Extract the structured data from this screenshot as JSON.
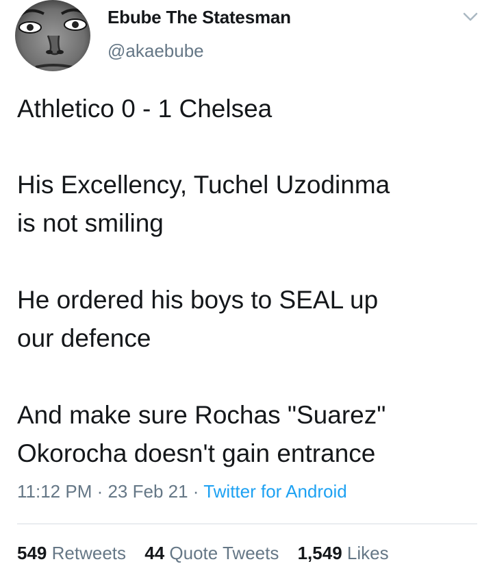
{
  "author": {
    "display_name": "Ebube The Statesman",
    "handle": "@akaebube"
  },
  "icons": {
    "menu": "chevron-down-icon",
    "avatar": "profile-photo"
  },
  "tweet": {
    "lines": [
      "Athletico 0 - 1 Chelsea",
      "His Excellency, Tuchel Uzodinma",
      "is not smiling",
      "He ordered his boys to SEAL up",
      "our defence",
      "And make sure Rochas \"Suarez\"",
      "Okorocha doesn't gain entrance"
    ]
  },
  "meta": {
    "time": "11:12 PM",
    "separator": " · ",
    "date": "23 Feb 21",
    "source": "Twitter for Android"
  },
  "stats": {
    "retweets_count": "549",
    "retweets_label": "Retweets",
    "quotes_count": "44",
    "quotes_label": "Quote Tweets",
    "likes_count": "1,549",
    "likes_label": "Likes"
  },
  "colors": {
    "text": "#14171a",
    "secondary": "#657786",
    "link": "#1da1f2",
    "divider": "#d7dde2"
  }
}
